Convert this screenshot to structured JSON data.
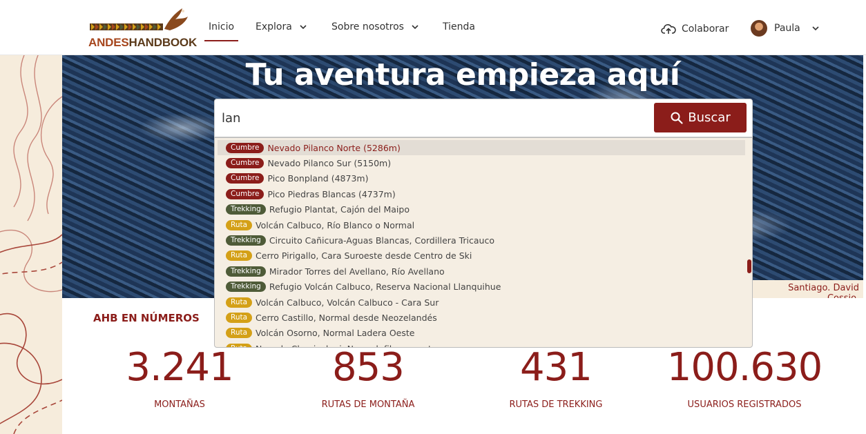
{
  "header": {
    "logo_text_a": "ANDES",
    "logo_text_b": "HANDBOOK",
    "nav": [
      {
        "label": "Inicio",
        "active": true
      },
      {
        "label": "Explora",
        "dropdown": true
      },
      {
        "label": "Sobre nosotros",
        "dropdown": true
      },
      {
        "label": "Tienda"
      }
    ],
    "collaborate_label": "Colaborar",
    "user_name": "Paula"
  },
  "hero": {
    "title": "Tu aventura empieza aquí",
    "credit": "Santiago. David Cossio."
  },
  "search": {
    "value": "lan",
    "button_label": "Buscar"
  },
  "suggestions": [
    {
      "badge": "Cumbre",
      "type": "cumbre",
      "text": "Nevado Pilanco Norte (5286m)",
      "selected": true
    },
    {
      "badge": "Cumbre",
      "type": "cumbre",
      "text": "Nevado Pilanco Sur (5150m)"
    },
    {
      "badge": "Cumbre",
      "type": "cumbre",
      "text": "Pico Bonpland (4873m)"
    },
    {
      "badge": "Cumbre",
      "type": "cumbre",
      "text": "Pico Piedras Blancas (4737m)"
    },
    {
      "badge": "Trekking",
      "type": "trekking",
      "text": "Refugio Plantat, Cajón del Maipo"
    },
    {
      "badge": "Ruta",
      "type": "ruta",
      "text": "Volcán Calbuco, Río Blanco o Normal"
    },
    {
      "badge": "Trekking",
      "type": "trekking",
      "text": "Circuito Cañicura-Aguas Blancas, Cordillera Tricauco"
    },
    {
      "badge": "Ruta",
      "type": "ruta",
      "text": "Cerro Pirigallo, Cara Suroeste desde Centro de Ski"
    },
    {
      "badge": "Trekking",
      "type": "trekking",
      "text": "Mirador Torres del Avellano, Río Avellano"
    },
    {
      "badge": "Trekking",
      "type": "trekking",
      "text": "Refugio Volcán Calbuco, Reserva Nacional Llanquihue"
    },
    {
      "badge": "Ruta",
      "type": "ruta",
      "text": "Volcán Calbuco, Volcán Calbuco - Cara Sur"
    },
    {
      "badge": "Ruta",
      "type": "ruta",
      "text": "Cerro Castillo, Normal desde Neozelandés"
    },
    {
      "badge": "Ruta",
      "type": "ruta",
      "text": "Volcán Osorno, Normal Ladera Oeste"
    },
    {
      "badge": "Ruta",
      "type": "ruta",
      "text": "Nevado Chopicalqui, Normal, filo suroeste"
    }
  ],
  "stats": {
    "heading": "AHB EN NÚMEROS",
    "items": [
      {
        "value": "3.241",
        "label": "MONTAÑAS"
      },
      {
        "value": "853",
        "label": "RUTAS DE MONTAÑA"
      },
      {
        "value": "431",
        "label": "RUTAS DE TREKKING"
      },
      {
        "value": "100.630",
        "label": "USUARIOS REGISTRADOS"
      }
    ]
  },
  "colors": {
    "brand": "#8b1d1a",
    "trekking": "#4e5b38",
    "ruta": "#d4a017",
    "cream": "#f6ecdc"
  }
}
